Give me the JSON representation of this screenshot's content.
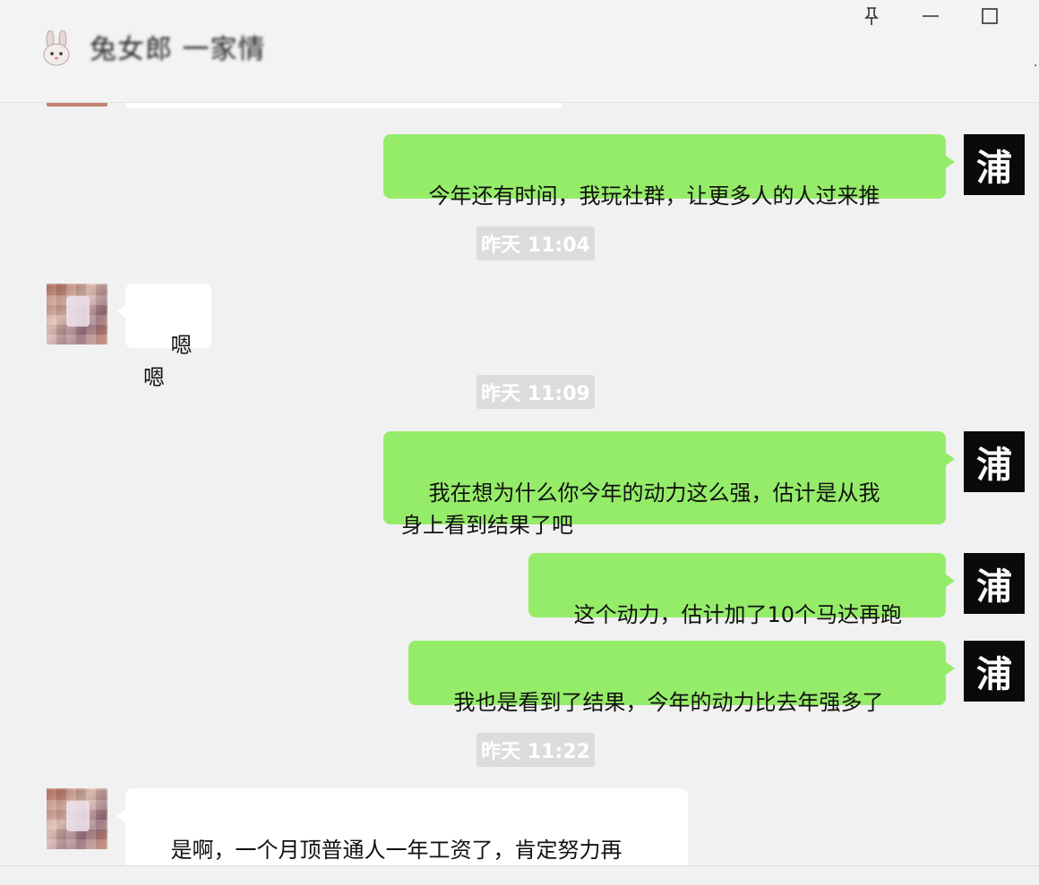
{
  "window": {
    "title": "兔女郎 一家情",
    "pin_icon": "pin-icon",
    "minimize_icon": "minimize-icon",
    "maximize_icon": "maximize-icon",
    "more_glyph": "·"
  },
  "messages": [
    {
      "side": "out",
      "text": "今年还有时间，我玩社群，让更多人的人过来推",
      "avatar": "浦"
    },
    {
      "type": "time",
      "text": "昨天 11:04"
    },
    {
      "side": "in",
      "text": "嗯嗯"
    },
    {
      "type": "time",
      "text": "昨天 11:09"
    },
    {
      "side": "out",
      "text": "我在想为什么你今年的动力这么强，估计是从我\n身上看到结果了吧",
      "avatar": "浦"
    },
    {
      "side": "out",
      "text": "这个动力，估计加了10个马达再跑",
      "avatar": "浦"
    },
    {
      "side": "out",
      "text": "我也是看到了结果，今年的动力比去年强多了",
      "avatar": "浦"
    },
    {
      "type": "time",
      "text": "昨天 11:22"
    },
    {
      "side": "in",
      "text": "是啊，一个月顶普通人一年工资了，肯定努力再\n努力了！以后还得好好跟你学习网络知识呢！太"
    }
  ],
  "colors": {
    "outgoing": "#95ec69",
    "incoming": "#ffffff",
    "background": "#f1f1f1"
  }
}
